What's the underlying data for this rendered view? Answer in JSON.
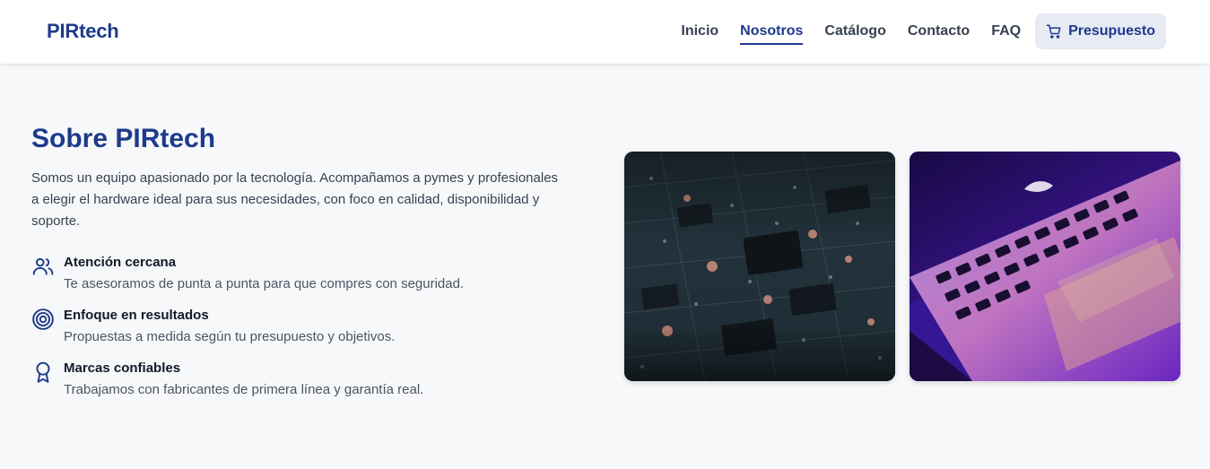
{
  "brand": {
    "logo": "PIRtech",
    "accent": "#1e3a8a"
  },
  "nav": {
    "items": [
      {
        "label": "Inicio",
        "active": false
      },
      {
        "label": "Nosotros",
        "active": true
      },
      {
        "label": "Catálogo",
        "active": false
      },
      {
        "label": "Contacto",
        "active": false
      },
      {
        "label": "FAQ",
        "active": false
      }
    ],
    "cta": {
      "label": "Presupuesto",
      "icon": "cart-icon"
    }
  },
  "about": {
    "title": "Sobre PIRtech",
    "description": "Somos un equipo apasionado por la tecnología. Acompañamos a pymes y profesionales a elegir el hardware ideal para sus necesidades, con foco en calidad, disponibilidad y soporte.",
    "features": [
      {
        "icon": "users-icon",
        "title": "Atención cercana",
        "text": "Te asesoramos de punta a punta para que compres con seguridad."
      },
      {
        "icon": "target-icon",
        "title": "Enfoque en resultados",
        "text": "Propuestas a medida según tu presupuesto y objetivos."
      },
      {
        "icon": "award-icon",
        "title": "Marcas confiables",
        "text": "Trabajamos con fabricantes de primera línea y garantía real."
      }
    ]
  },
  "images": [
    {
      "subject": "circuit-board-photo"
    },
    {
      "subject": "laptop-photo"
    }
  ]
}
